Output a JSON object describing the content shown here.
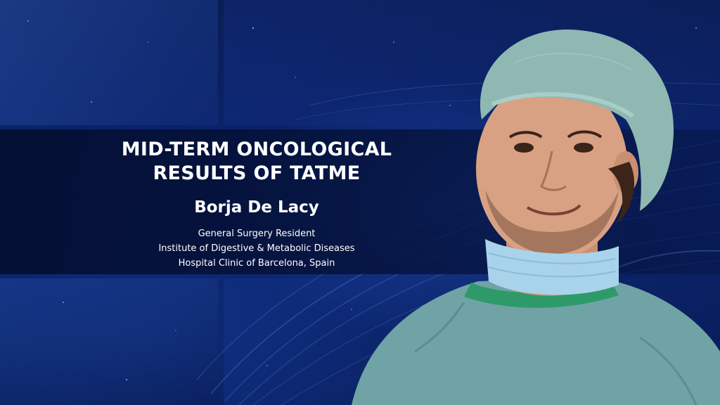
{
  "slide": {
    "title_line1": "MID-TERM ONCOLOGICAL",
    "title_line2": "RESULTS OF TATME",
    "speaker_name": "Borja De Lacy",
    "affiliation": [
      "General Surgery Resident",
      "Institute of Digestive & Metabolic Diseases",
      "Hospital Clinic of Barcelona, Spain"
    ]
  },
  "colors": {
    "background": "#0b2470",
    "band": "#050f3a",
    "text": "#ffffff",
    "scrubs": "#6fa3a6",
    "mask": "#a9d3ea",
    "cap": "#8fb8b2",
    "collar": "#2e9a6a"
  },
  "icons": {
    "portrait": "surgeon-portrait"
  }
}
